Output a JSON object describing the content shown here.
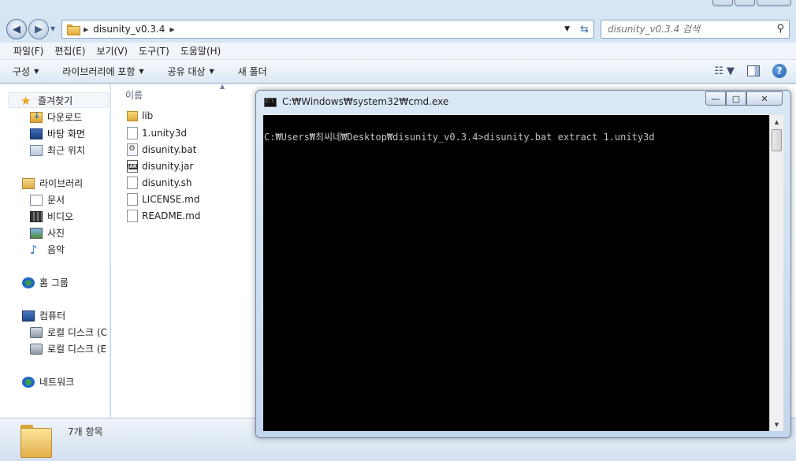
{
  "explorer": {
    "address": {
      "crumbs": [
        "disunity_v0.3.4"
      ],
      "search_placeholder": "disunity_v0.3.4 검색"
    },
    "menu": [
      "파일(F)",
      "편집(E)",
      "보기(V)",
      "도구(T)",
      "도움말(H)"
    ],
    "toolbar": {
      "organize": "구성",
      "include_library": "라이브러리에 포함",
      "share": "공유 대상",
      "new_folder": "새 폴더"
    },
    "nav": {
      "favorites": "즐겨찾기",
      "downloads": "다운로드",
      "desktop": "바탕 화면",
      "recent": "최근 위치",
      "libraries": "라이브러리",
      "documents": "문서",
      "videos": "비디오",
      "pictures": "사진",
      "music": "음악",
      "homegroup": "홈 그룹",
      "computer": "컴퓨터",
      "drive_c": "로컬 디스크 (C",
      "drive_e": "로컬 디스크 (E",
      "network": "네트워크"
    },
    "files": {
      "column_name": "이름",
      "items": [
        {
          "name": "lib",
          "type": "folder"
        },
        {
          "name": "1.unity3d",
          "type": "file"
        },
        {
          "name": "disunity.bat",
          "type": "bat"
        },
        {
          "name": "disunity.jar",
          "type": "jar"
        },
        {
          "name": "disunity.sh",
          "type": "file"
        },
        {
          "name": "LICENSE.md",
          "type": "file"
        },
        {
          "name": "README.md",
          "type": "file"
        }
      ]
    },
    "status": {
      "item_count": "7개 항목"
    }
  },
  "cmd": {
    "title": "C:₩Windows₩system32₩cmd.exe",
    "icon_text": "C:\\",
    "lines": [
      "C:₩Users₩최씨네₩Desktop₩disunity_v0.3.4>disunity.bat extract 1.unity3d"
    ]
  }
}
